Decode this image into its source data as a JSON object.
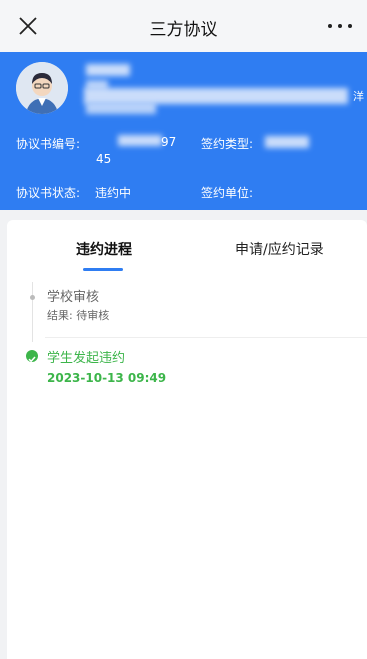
{
  "header": {
    "title": "三方协议",
    "close_icon": "close-icon",
    "more_icon": "more-icon"
  },
  "profile": {
    "name_suffix": "洋",
    "agreement_no_label": "协议书编号:",
    "agreement_no_part1": "97",
    "agreement_no_part2": "45",
    "sign_type_label": "签约类型:",
    "status_label": "协议书状态:",
    "status_value": "违约中",
    "sign_unit_label": "签约单位:"
  },
  "tabs": [
    {
      "label": "违约进程",
      "active": true
    },
    {
      "label": "申请/应约记录",
      "active": false
    }
  ],
  "timeline": [
    {
      "title": "学校审核",
      "result_label": "结果:",
      "result_value": "待审核",
      "state": "pending"
    },
    {
      "title": "学生发起违约",
      "time": "2023-10-13 09:49",
      "state": "done"
    }
  ],
  "colors": {
    "primary": "#2f7df2",
    "success": "#3cb54a"
  }
}
